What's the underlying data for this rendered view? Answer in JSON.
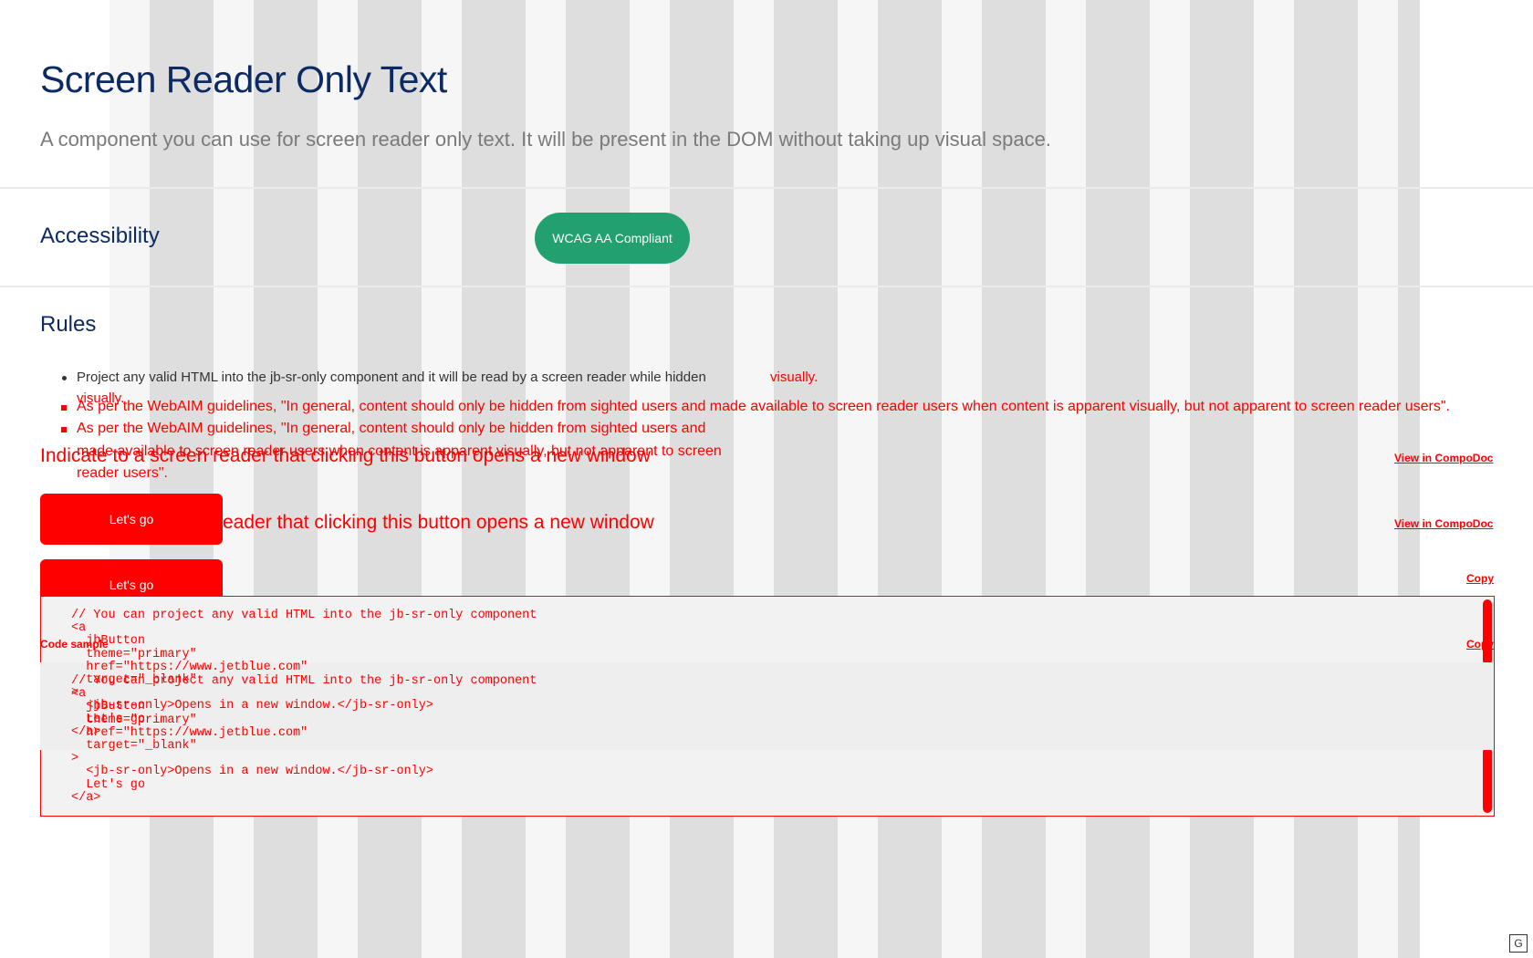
{
  "header": {
    "title": "Screen Reader Only Text",
    "description": "A component you can use for screen reader only text. It will be present in the DOM without taking up visual space."
  },
  "accessibility": {
    "title": "Accessibility",
    "badge": "WCAG AA Compliant"
  },
  "rules": {
    "title": "Rules",
    "items": [
      {
        "text": "Project any valid HTML into the jb-sr-only component and it will be read by a screen reader while hidden ",
        "tail": "visually."
      },
      {
        "text": "As per the WebAIM guidelines, \"In general, content should only be hidden from sighted users and made available to screen reader users when content is apparent visually, but not apparent to screen reader users\"."
      }
    ],
    "overlay_tail": "visually.",
    "overlay_line": "As per the WebAIM guidelines, \"In general, content should only be hidden from sighted users and made available to screen reader users when content is apparent visually, but not apparent to screen reader users\".",
    "overlay_wrap_1": "As per the WebAIM guidelines, \"In general, content should only be hidden from sighted users and",
    "overlay_wrap_2": "made available to screen reader users when content is apparent visually, but not apparent to screen",
    "overlay_wrap_3": "reader users\"."
  },
  "example": {
    "title": "Indicate to a screen reader that clicking this button opens a new window",
    "title_partial": "eader that clicking this button opens a new window",
    "compodoc_link": "View in CompoDoc",
    "button_label": "Let's go",
    "copy_label": "Copy",
    "code_sample_label": "Code sample",
    "code": "// You can project any valid HTML into the jb-sr-only component\n<a\n  jbButton\n  theme=\"primary\"\n  href=\"https://www.jetblue.com\"\n  target=\"_blank\"\n>\n  <jb-sr-only>Opens in a new window.</jb-sr-only>\n  Let's go\n</a>"
  },
  "corner_badge": "G"
}
